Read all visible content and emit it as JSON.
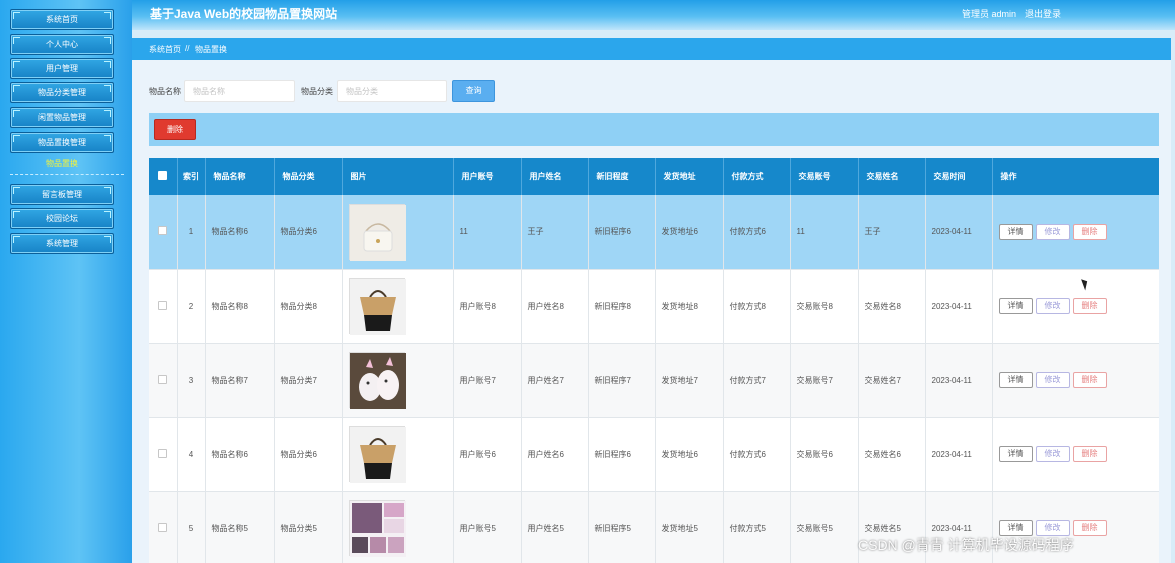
{
  "header": {
    "title": "基于Java Web的校园物品置换网站",
    "user": "管理员 admin",
    "logout": "退出登录"
  },
  "sidebar": {
    "items": [
      {
        "label": "系统首页"
      },
      {
        "label": "个人中心"
      },
      {
        "label": "用户管理"
      },
      {
        "label": "物品分类管理"
      },
      {
        "label": "闲置物品管理"
      },
      {
        "label": "物品置换管理"
      }
    ],
    "sub_item": "物品置换",
    "items_after": [
      {
        "label": "留言板管理"
      },
      {
        "label": "校园论坛"
      },
      {
        "label": "系统管理"
      }
    ]
  },
  "breadcrumb": {
    "home": "系统首页",
    "separator": "//",
    "current": "物品置换"
  },
  "search": {
    "name_label": "物品名称",
    "name_placeholder": "物品名称",
    "category_label": "物品分类",
    "category_placeholder": "物品分类",
    "button": "查询"
  },
  "toolbar": {
    "delete_label": "删除"
  },
  "table": {
    "headers": [
      "索引",
      "物品名称",
      "物品分类",
      "图片",
      "用户账号",
      "用户姓名",
      "新旧程度",
      "发货地址",
      "付款方式",
      "交易账号",
      "交易姓名",
      "交易时间",
      "操作"
    ],
    "actions": {
      "detail": "详情",
      "edit": "修改",
      "delete": "删除"
    },
    "rows": [
      {
        "index": "1",
        "name": "物品名称6",
        "category": "物品分类6",
        "image": "bag-white",
        "user_account": "11",
        "user_name": "王子",
        "condition": "新旧程序6",
        "address": "发货地址6",
        "payment": "付款方式6",
        "trade_account": "11",
        "trade_name": "王子",
        "trade_time": "2023-04-11"
      },
      {
        "index": "2",
        "name": "物品名称8",
        "category": "物品分类8",
        "image": "bag-tote",
        "user_account": "用户账号8",
        "user_name": "用户姓名8",
        "condition": "新旧程序8",
        "address": "发货地址8",
        "payment": "付款方式8",
        "trade_account": "交易账号8",
        "trade_name": "交易姓名8",
        "trade_time": "2023-04-11"
      },
      {
        "index": "3",
        "name": "物品名称7",
        "category": "物品分类7",
        "image": "unicorn-toy",
        "user_account": "用户账号7",
        "user_name": "用户姓名7",
        "condition": "新旧程序7",
        "address": "发货地址7",
        "payment": "付款方式7",
        "trade_account": "交易账号7",
        "trade_name": "交易姓名7",
        "trade_time": "2023-04-11"
      },
      {
        "index": "4",
        "name": "物品名称6",
        "category": "物品分类6",
        "image": "bag-tote",
        "user_account": "用户账号6",
        "user_name": "用户姓名6",
        "condition": "新旧程序6",
        "address": "发货地址6",
        "payment": "付款方式6",
        "trade_account": "交易账号6",
        "trade_name": "交易姓名6",
        "trade_time": "2023-04-11"
      },
      {
        "index": "5",
        "name": "物品名称5",
        "category": "物品分类5",
        "image": "collage",
        "user_account": "用户账号5",
        "user_name": "用户姓名5",
        "condition": "新旧程序5",
        "address": "发货地址5",
        "payment": "付款方式5",
        "trade_account": "交易账号5",
        "trade_name": "交易姓名5",
        "trade_time": "2023-04-11"
      }
    ]
  },
  "watermark": "CSDN @青青  计算机毕设源码程序"
}
